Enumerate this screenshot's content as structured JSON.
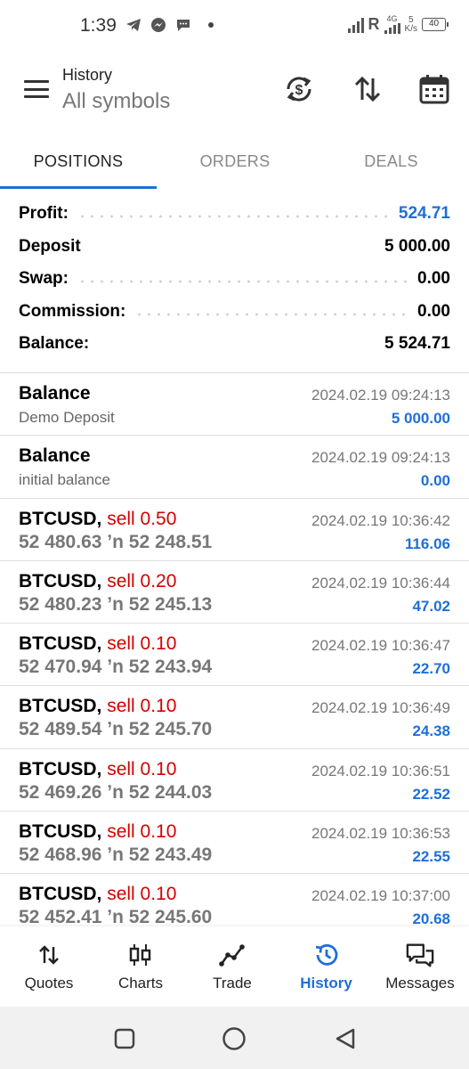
{
  "status_bar": {
    "time": "1:39",
    "network": "R",
    "net_type": "4G",
    "speed_value": "5",
    "speed_unit": "K/s",
    "battery": "40"
  },
  "header": {
    "title": "History",
    "subtitle": "All symbols"
  },
  "tabs": [
    {
      "label": "POSITIONS",
      "active": true
    },
    {
      "label": "ORDERS",
      "active": false
    },
    {
      "label": "DEALS",
      "active": false
    }
  ],
  "summary": [
    {
      "label": "Profit:",
      "value": "524.71"
    },
    {
      "label": "Deposit",
      "value": "5 000.00"
    },
    {
      "label": "Swap:",
      "value": "0.00"
    },
    {
      "label": "Commission:",
      "value": "0.00"
    },
    {
      "label": "Balance:",
      "value": "5 524.71"
    }
  ],
  "entries": [
    {
      "title": "Balance",
      "detail": "Demo Deposit",
      "time": "2024.02.19 09:24:13",
      "amount": "5 000.00"
    },
    {
      "title": "Balance",
      "detail": "initial balance",
      "time": "2024.02.19 09:24:13",
      "amount": "0.00"
    }
  ],
  "trades": [
    {
      "symbol": "BTCUSD,",
      "side": "sell 0.50",
      "open": "52 480.63",
      "arrow": "ʼn",
      "close": "52 248.51",
      "time": "2024.02.19 10:36:42",
      "profit": "116.06"
    },
    {
      "symbol": "BTCUSD,",
      "side": "sell 0.20",
      "open": "52 480.23",
      "arrow": "ʼn",
      "close": "52 245.13",
      "time": "2024.02.19 10:36:44",
      "profit": "47.02"
    },
    {
      "symbol": "BTCUSD,",
      "side": "sell 0.10",
      "open": "52 470.94",
      "arrow": "ʼn",
      "close": "52 243.94",
      "time": "2024.02.19 10:36:47",
      "profit": "22.70"
    },
    {
      "symbol": "BTCUSD,",
      "side": "sell 0.10",
      "open": "52 489.54",
      "arrow": "ʼn",
      "close": "52 245.70",
      "time": "2024.02.19 10:36:49",
      "profit": "24.38"
    },
    {
      "symbol": "BTCUSD,",
      "side": "sell 0.10",
      "open": "52 469.26",
      "arrow": "ʼn",
      "close": "52 244.03",
      "time": "2024.02.19 10:36:51",
      "profit": "22.52"
    },
    {
      "symbol": "BTCUSD,",
      "side": "sell 0.10",
      "open": "52 468.96",
      "arrow": "ʼn",
      "close": "52 243.49",
      "time": "2024.02.19 10:36:53",
      "profit": "22.55"
    },
    {
      "symbol": "BTCUSD,",
      "side": "sell 0.10",
      "open": "52 452.41",
      "arrow": "ʼn",
      "close": "52 245.60",
      "time": "2024.02.19 10:37:00",
      "profit": "20.68"
    }
  ],
  "bottom_nav": [
    {
      "label": "Quotes",
      "icon": "quotes-icon"
    },
    {
      "label": "Charts",
      "icon": "charts-icon"
    },
    {
      "label": "Trade",
      "icon": "trade-icon"
    },
    {
      "label": "History",
      "icon": "history-icon",
      "active": true
    },
    {
      "label": "Messages",
      "icon": "messages-icon"
    }
  ],
  "colors": {
    "accent": "#1e6fd9",
    "sell": "#d40000"
  }
}
